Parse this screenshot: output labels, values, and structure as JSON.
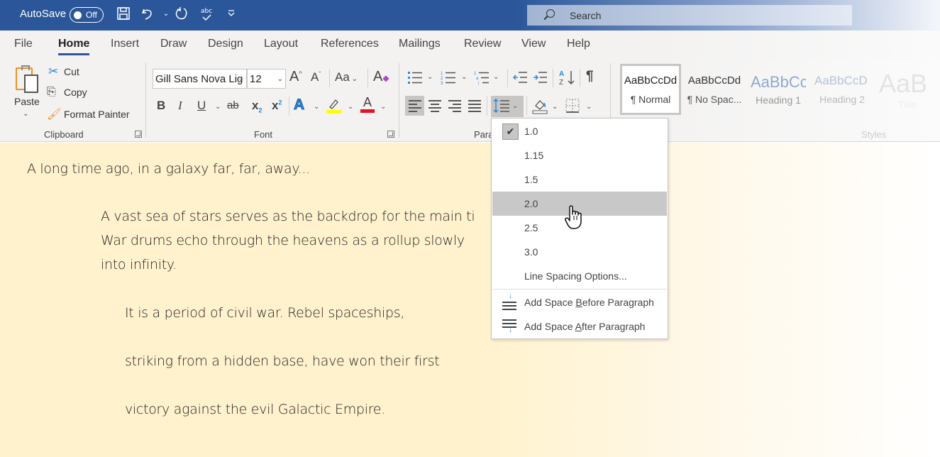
{
  "titlebar": {
    "autosave_label": "AutoSave",
    "autosave_state": "Off",
    "search_placeholder": "Search",
    "quick_access": [
      "save-icon",
      "undo-icon",
      "redo-icon",
      "spelling-icon",
      "customize-icon"
    ]
  },
  "tabs": [
    {
      "label": "File",
      "active": false
    },
    {
      "label": "Home",
      "active": true
    },
    {
      "label": "Insert",
      "active": false
    },
    {
      "label": "Draw",
      "active": false
    },
    {
      "label": "Design",
      "active": false
    },
    {
      "label": "Layout",
      "active": false
    },
    {
      "label": "References",
      "active": false
    },
    {
      "label": "Mailings",
      "active": false
    },
    {
      "label": "Review",
      "active": false
    },
    {
      "label": "View",
      "active": false
    },
    {
      "label": "Help",
      "active": false
    }
  ],
  "clipboard": {
    "paste": "Paste",
    "cut": "Cut",
    "copy": "Copy",
    "format_painter": "Format Painter",
    "group_label": "Clipboard"
  },
  "font": {
    "font_name": "Gill Sans Nova Lig",
    "font_size": "12",
    "group_label": "Font",
    "bold": "B",
    "italic": "I",
    "underline": "U",
    "strike": "ab",
    "subscript": "x",
    "superscript": "x",
    "change_case": "Aa",
    "grow": "A",
    "shrink": "A",
    "effects": "A",
    "font_color": "A",
    "highlight_color": "#ffff00",
    "font_color_value": "#e81123"
  },
  "paragraph": {
    "group_label": "Para",
    "pilcrow": "¶"
  },
  "styles": {
    "group_label": "Styles",
    "items": [
      {
        "sample": "AaBbCcDd",
        "name": "¶ Normal"
      },
      {
        "sample": "AaBbCcDd",
        "name": "¶ No Spac..."
      },
      {
        "sample": "AaBbCc",
        "name": "Heading 1"
      },
      {
        "sample": "AaBbCcD",
        "name": "Heading 2"
      },
      {
        "sample": "AaB",
        "name": "Title"
      }
    ]
  },
  "line_spacing_menu": {
    "selected": "1.0",
    "hovered": "2.0",
    "options": [
      "1.0",
      "1.15",
      "1.5",
      "2.0",
      "2.5",
      "3.0"
    ],
    "options_link": "Line Spacing Options...",
    "add_before": {
      "pre": "Add Space ",
      "key": "B",
      "post": "efore Paragraph"
    },
    "add_after": {
      "pre": "Add Space ",
      "key": "A",
      "post": "fter Paragraph"
    }
  },
  "document": {
    "lines": [
      "A long time ago, in a galaxy far, far, away...",
      "A vast sea of stars serves as the backdrop for the main ti",
      "War drums echo through the heavens as a rollup slowly",
      "into infinity.",
      "It is a period of civil war. Rebel spaceships,",
      "striking from a hidden base, have won their first",
      "victory against the evil Galactic Empire."
    ]
  }
}
